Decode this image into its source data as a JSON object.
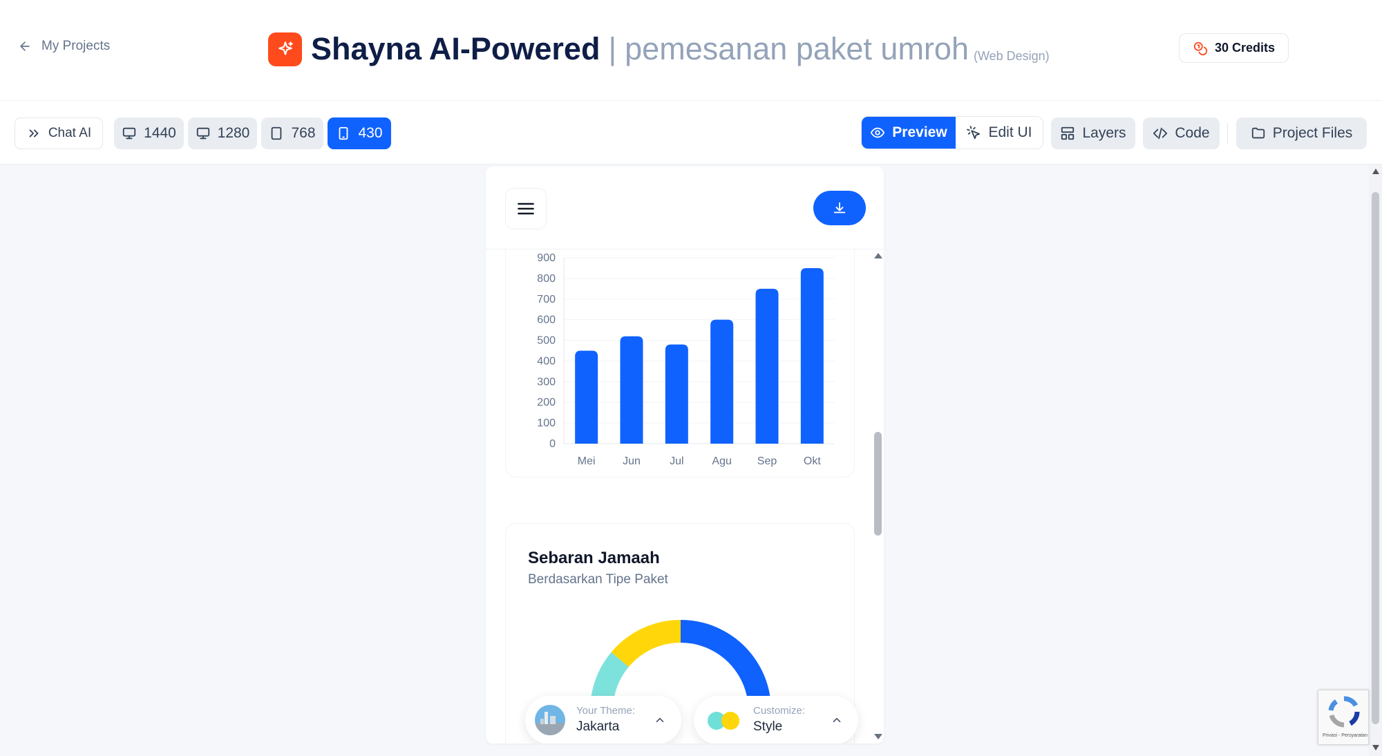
{
  "header": {
    "back_label": "My Projects",
    "app_title": "Shayna AI-Powered",
    "separator": "|",
    "project_name": "pemesanan paket umroh",
    "project_type": "(Web Design)",
    "credits_label": "30 Credits"
  },
  "toolbar": {
    "chat_label": "Chat AI",
    "viewports": [
      {
        "label": "1440",
        "icon": "monitor-icon",
        "active": false
      },
      {
        "label": "1280",
        "icon": "monitor-icon",
        "active": false
      },
      {
        "label": "768",
        "icon": "tablet-icon",
        "active": false
      },
      {
        "label": "430",
        "icon": "phone-icon",
        "active": true
      }
    ],
    "preview_label": "Preview",
    "edit_label": "Edit UI",
    "layers_label": "Layers",
    "code_label": "Code",
    "files_label": "Project Files"
  },
  "preview": {
    "pie_title": "Sebaran Jamaah",
    "pie_subtitle": "Berdasarkan Tipe Paket",
    "theme_label": "Your Theme:",
    "theme_value": "Jakarta",
    "customize_label": "Customize:",
    "customize_value": "Style"
  },
  "recaptcha": {
    "text": "Privasi - Persyaratan"
  },
  "colors": {
    "accent": "#0f62fe",
    "logo": "#ff4a1c",
    "teal": "#7ee2dc",
    "yellow": "#ffd60a"
  },
  "chart_data": [
    {
      "type": "bar",
      "categories": [
        "Mei",
        "Jun",
        "Jul",
        "Agu",
        "Sep",
        "Okt"
      ],
      "values": [
        450,
        520,
        480,
        600,
        750,
        850
      ],
      "ylim": [
        0,
        900
      ],
      "yticks": [
        0,
        100,
        200,
        300,
        400,
        500,
        600,
        700,
        800,
        900
      ],
      "color": "#0f62fe",
      "grid": true
    },
    {
      "type": "pie",
      "variant": "donut",
      "title": "Sebaran Jamaah",
      "subtitle": "Berdasarkan Tipe Paket",
      "visible_portion": "upper half only, chart cut off at bottom",
      "colors": [
        "#0f62fe",
        "#7ee2dc",
        "#ffd60a"
      ]
    }
  ]
}
